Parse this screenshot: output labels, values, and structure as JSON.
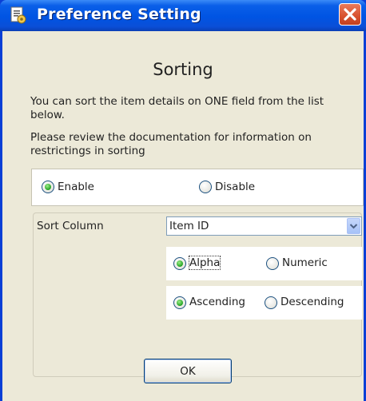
{
  "window": {
    "title": "Preference Setting",
    "icon": "settings-document-icon",
    "close_icon": "close-icon"
  },
  "dialog": {
    "heading": "Sorting",
    "info1": "You can sort the item details on ONE field from the list below.",
    "info2": "Please review the documentation for information on restrictings in sorting"
  },
  "enable_group": {
    "enable_label": "Enable",
    "disable_label": "Disable",
    "selected": "Enable"
  },
  "sort": {
    "column_label": "Sort Column",
    "column_value": "Item ID",
    "type_alpha": "Alpha",
    "type_numeric": "Numeric",
    "type_selected": "Alpha",
    "order_ascending": "Ascending",
    "order_descending": "Descending",
    "order_selected": "Ascending"
  },
  "buttons": {
    "ok": "OK"
  },
  "colors": {
    "titlebar": "#0054e3",
    "dialog_bg": "#ece9d8",
    "close_button": "#d8512e",
    "radio_selected": "#21a121"
  }
}
